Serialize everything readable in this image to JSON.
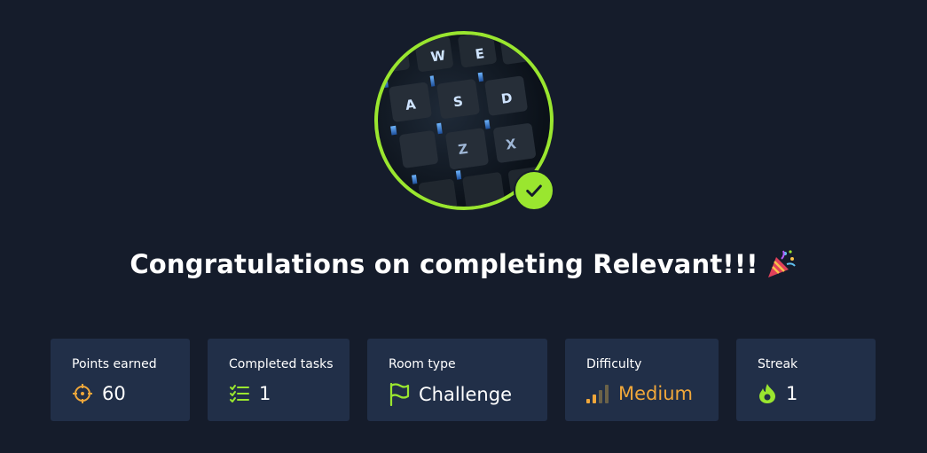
{
  "title": "Congratulations on completing Relevant!!!",
  "icons": {
    "avatar": "keyboard-image",
    "badge": "check-icon",
    "title_emoji": "party-popper-icon"
  },
  "colors": {
    "background": "#151c2b",
    "card": "#212f48",
    "accent_green": "#9ae62f",
    "accent_orange": "#f0a73a"
  },
  "stats": [
    {
      "label": "Points earned",
      "value": "60",
      "icon": "target-icon"
    },
    {
      "label": "Completed tasks",
      "value": "1",
      "icon": "checklist-icon"
    },
    {
      "label": "Room type",
      "value": "Challenge",
      "icon": "flag-icon"
    },
    {
      "label": "Difficulty",
      "value": "Medium",
      "icon": "difficulty-bars-icon"
    },
    {
      "label": "Streak",
      "value": "1",
      "icon": "flame-icon"
    }
  ]
}
